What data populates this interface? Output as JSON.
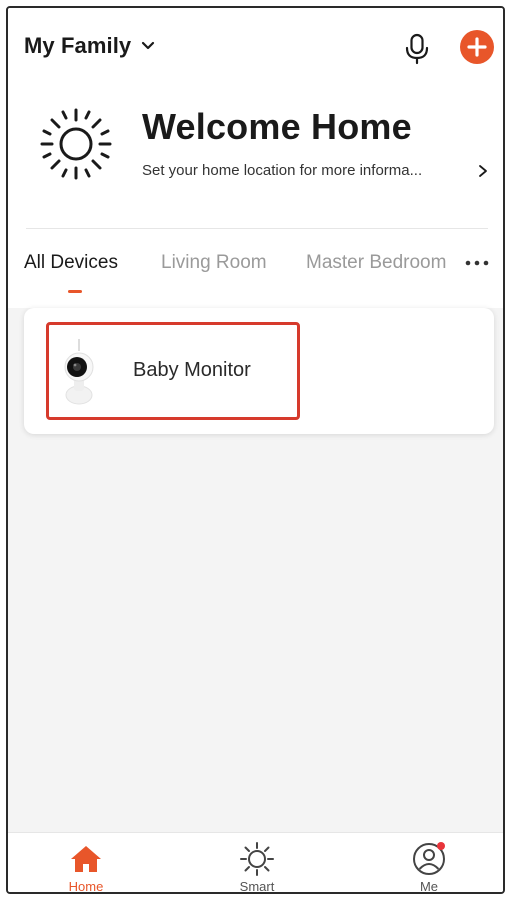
{
  "header": {
    "family_name": "My Family"
  },
  "welcome": {
    "title": "Welcome Home",
    "subtitle": "Set your home location for more informa..."
  },
  "tabs": [
    {
      "label": "All Devices",
      "active": true
    },
    {
      "label": "Living Room",
      "active": false
    },
    {
      "label": "Master Bedroom",
      "active": false
    }
  ],
  "devices": [
    {
      "name": "Baby Monitor",
      "icon": "camera-device-icon"
    }
  ],
  "bottom_nav": [
    {
      "label": "Home",
      "icon": "home-icon",
      "active": true
    },
    {
      "label": "Smart",
      "icon": "smart-sun-icon",
      "active": false
    },
    {
      "label": "Me",
      "icon": "profile-icon",
      "active": false,
      "has_notification_dot": true
    }
  ],
  "colors": {
    "accent": "#e8562a",
    "highlight_border": "#d63a2c",
    "background": "#f4f4f4",
    "inactive_text": "#9a9a9a"
  }
}
